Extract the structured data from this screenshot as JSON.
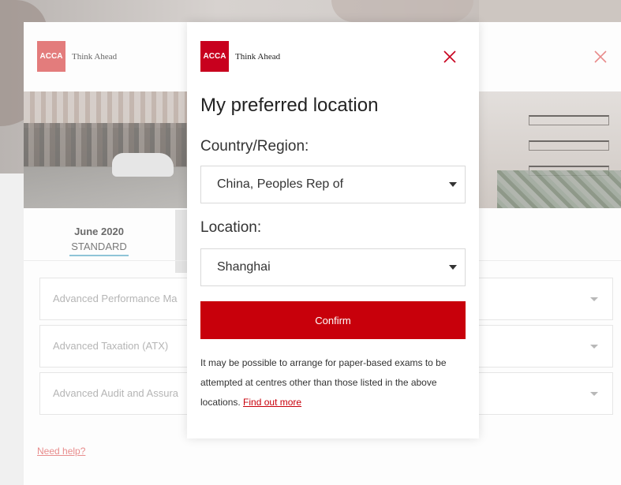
{
  "background": {
    "logo": {
      "mark": "ACCA",
      "tagline": "Think Ahead"
    },
    "close_icon": "close-icon",
    "tab": {
      "date": "June 2020",
      "label": "STANDARD"
    },
    "accordion": [
      {
        "label": "Advanced Performance Ma"
      },
      {
        "label": "Advanced Taxation (ATX)"
      },
      {
        "label": "Advanced Audit and Assura"
      }
    ],
    "help_link": "Need help?"
  },
  "modal": {
    "logo": {
      "mark": "ACCA",
      "tagline": "Think Ahead"
    },
    "close_icon": "close-icon",
    "title": "My preferred location",
    "country_label": "Country/Region:",
    "country_value": "China, Peoples Rep of",
    "location_label": "Location:",
    "location_value": "Shanghai",
    "confirm_label": "Confirm",
    "note_text": "It may be possible to arrange for paper-based exams to be attempted at centres other than those listed in the above locations.",
    "note_link": "Find out more"
  },
  "colors": {
    "brand_red": "#c8001e",
    "button_red": "#c8000b",
    "tab_underline": "#8fc4d8"
  }
}
